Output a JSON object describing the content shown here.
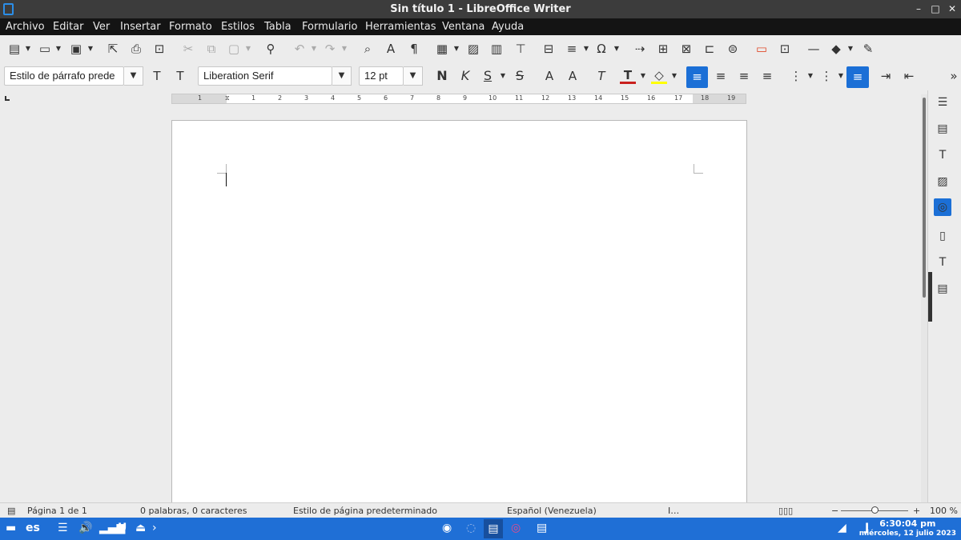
{
  "window": {
    "title": "Sin título 1 - LibreOffice Writer"
  },
  "menu": [
    "Archivo",
    "Editar",
    "Ver",
    "Insertar",
    "Formato",
    "Estilos",
    "Tabla",
    "Formulario",
    "Herramientas",
    "Ventana",
    "Ayuda"
  ],
  "format_bar": {
    "paragraph_style": "Estilo de párrafo prede",
    "font_name": "Liberation Serif",
    "font_size": "12 pt",
    "bold": "N",
    "italic": "K",
    "underline": "S",
    "strike": "S"
  },
  "ruler": {
    "ticks": [
      "1",
      "1",
      "1",
      "2",
      "3",
      "4",
      "5",
      "6",
      "7",
      "8",
      "9",
      "10",
      "11",
      "12",
      "13",
      "14",
      "15",
      "16",
      "17",
      "18",
      "19"
    ]
  },
  "status": {
    "page": "Página 1 de 1",
    "words": "0 palabras, 0 caracteres",
    "page_style": "Estilo de página predeterminado",
    "language": "Español (Venezuela)",
    "zoom": "100 %",
    "zoom_minus": "−",
    "zoom_plus": "+"
  },
  "taskbar": {
    "keyboard_layout": "es",
    "time": "6:30:04 pm",
    "date": "miércoles, 12 julio 2023"
  },
  "colors": {
    "accent": "#1b6fd6",
    "taskbar": "#1f6fd6",
    "font_color": "#c9211e",
    "highlight": "#ffff00"
  }
}
